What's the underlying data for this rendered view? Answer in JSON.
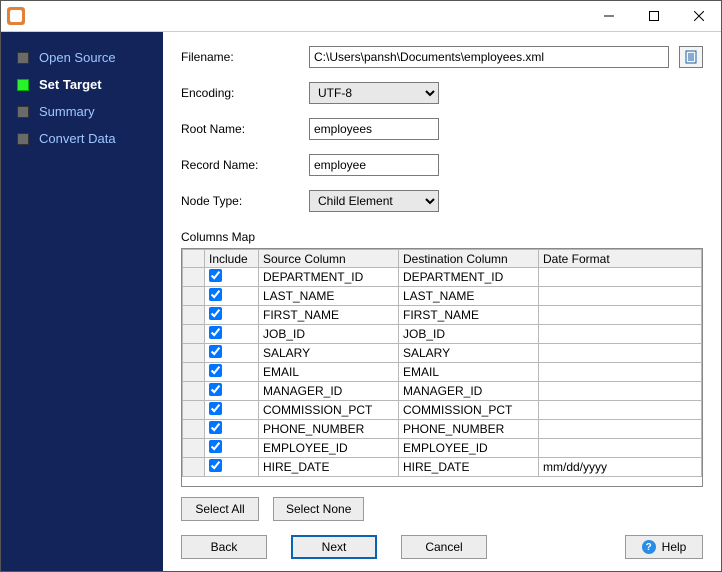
{
  "window": {
    "title": ""
  },
  "sidebar": {
    "items": [
      {
        "label": "Open Source",
        "active": false
      },
      {
        "label": "Set Target",
        "active": true
      },
      {
        "label": "Summary",
        "active": false
      },
      {
        "label": "Convert Data",
        "active": false
      }
    ]
  },
  "form": {
    "filename_label": "Filename:",
    "filename_value": "C:\\Users\\pansh\\Documents\\employees.xml",
    "encoding_label": "Encoding:",
    "encoding_value": "UTF-8",
    "rootname_label": "Root Name:",
    "rootname_value": "employees",
    "recordname_label": "Record Name:",
    "recordname_value": "employee",
    "nodetype_label": "Node Type:",
    "nodetype_value": "Child Element"
  },
  "columns_map": {
    "title": "Columns Map",
    "headers": {
      "include": "Include",
      "source": "Source Column",
      "destination": "Destination Column",
      "date_format": "Date Format"
    },
    "rows": [
      {
        "include": true,
        "source": "DEPARTMENT_ID",
        "destination": "DEPARTMENT_ID",
        "date_format": ""
      },
      {
        "include": true,
        "source": "LAST_NAME",
        "destination": "LAST_NAME",
        "date_format": ""
      },
      {
        "include": true,
        "source": "FIRST_NAME",
        "destination": "FIRST_NAME",
        "date_format": ""
      },
      {
        "include": true,
        "source": "JOB_ID",
        "destination": "JOB_ID",
        "date_format": ""
      },
      {
        "include": true,
        "source": "SALARY",
        "destination": "SALARY",
        "date_format": ""
      },
      {
        "include": true,
        "source": "EMAIL",
        "destination": "EMAIL",
        "date_format": ""
      },
      {
        "include": true,
        "source": "MANAGER_ID",
        "destination": "MANAGER_ID",
        "date_format": ""
      },
      {
        "include": true,
        "source": "COMMISSION_PCT",
        "destination": "COMMISSION_PCT",
        "date_format": ""
      },
      {
        "include": true,
        "source": "PHONE_NUMBER",
        "destination": "PHONE_NUMBER",
        "date_format": ""
      },
      {
        "include": true,
        "source": "EMPLOYEE_ID",
        "destination": "EMPLOYEE_ID",
        "date_format": ""
      },
      {
        "include": true,
        "source": "HIRE_DATE",
        "destination": "HIRE_DATE",
        "date_format": "mm/dd/yyyy"
      }
    ]
  },
  "buttons": {
    "select_all": "Select All",
    "select_none": "Select None",
    "back": "Back",
    "next": "Next",
    "cancel": "Cancel",
    "help": "Help"
  }
}
